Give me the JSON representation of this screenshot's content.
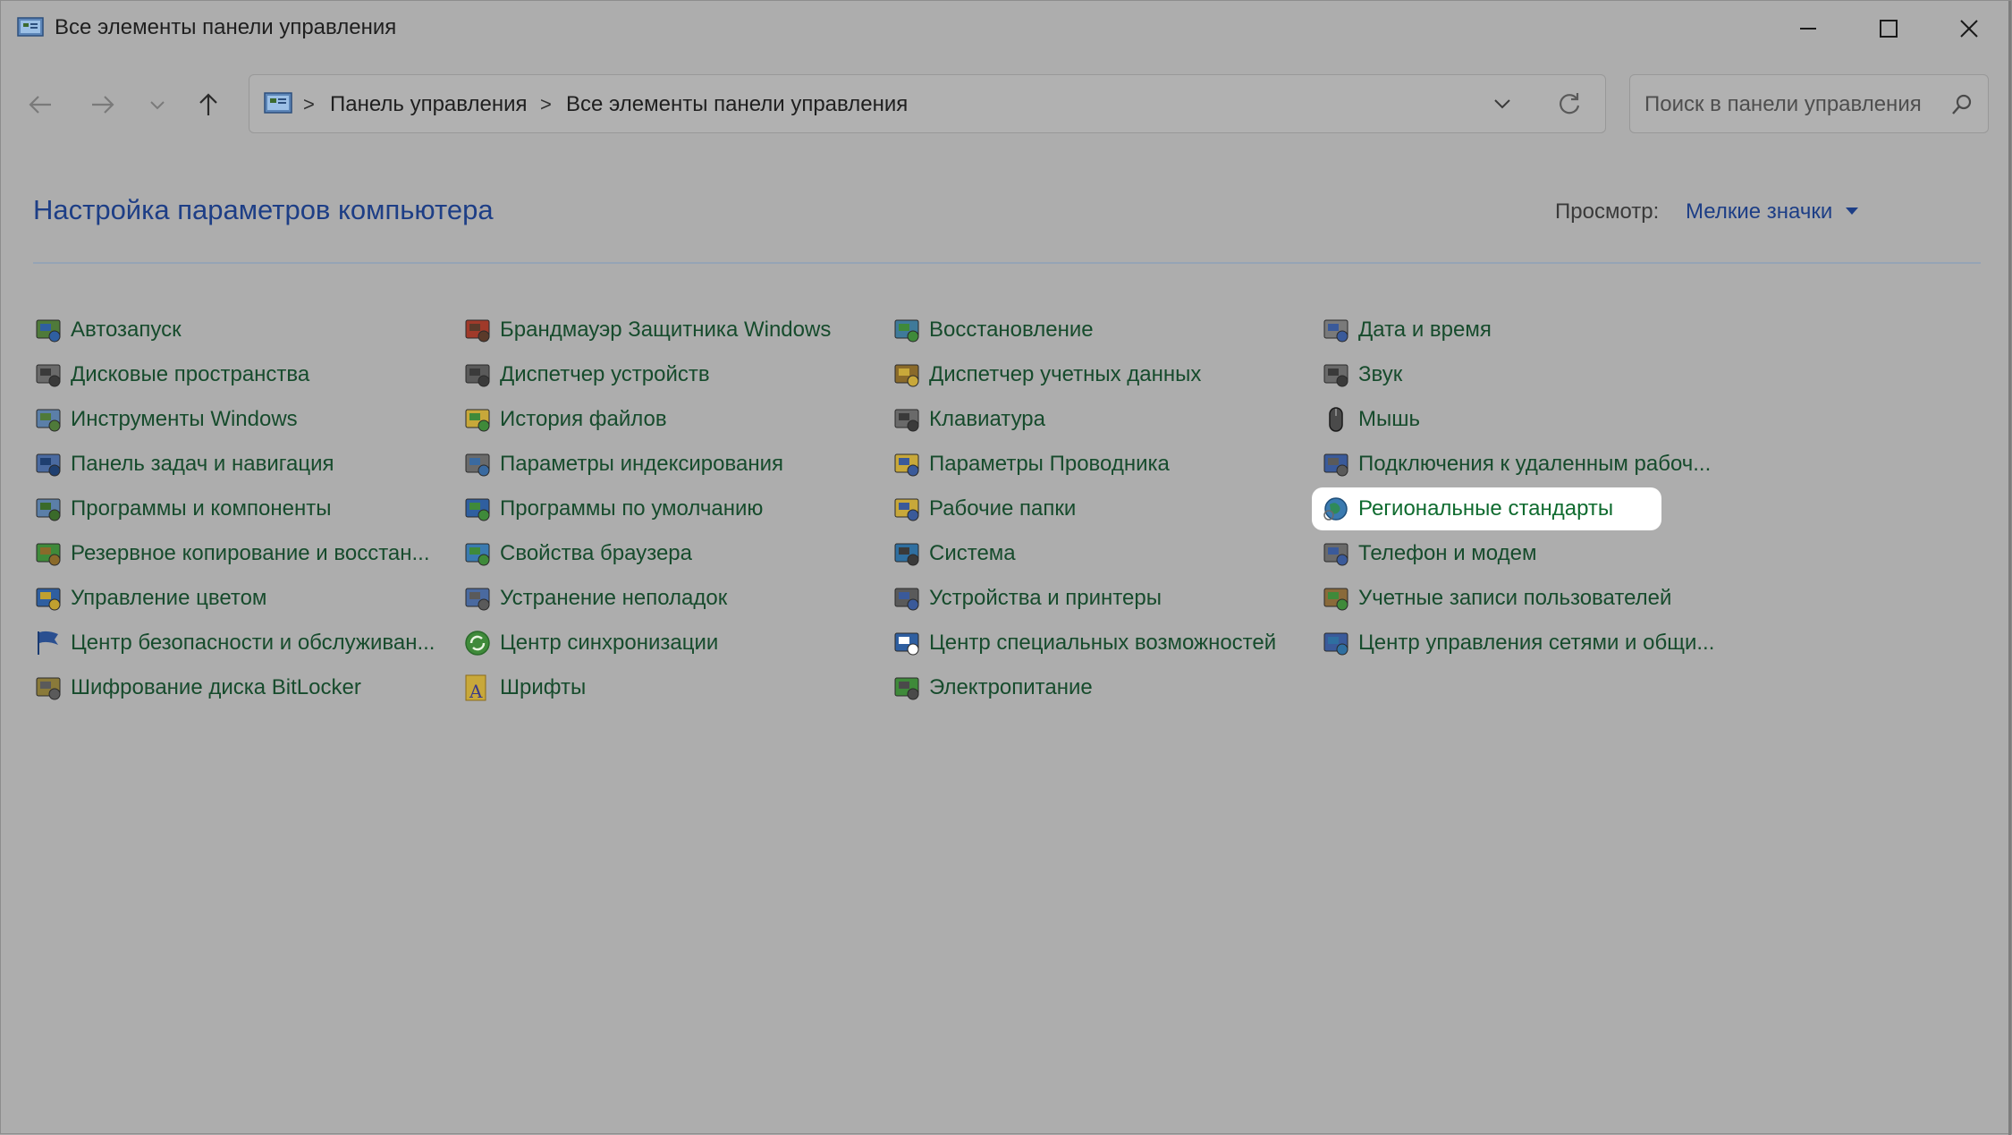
{
  "window": {
    "title": "Все элементы панели управления",
    "controls": {
      "minimize": "minimize-icon",
      "maximize": "maximize-icon",
      "close": "close-icon"
    }
  },
  "nav": {
    "back": "back-arrow-icon",
    "forward": "forward-arrow-icon",
    "recent": "chevron-down-icon",
    "up": "up-arrow-icon"
  },
  "address": {
    "crumbs": [
      "Панель управления",
      "Все элементы панели управления"
    ],
    "separator": ">"
  },
  "search": {
    "placeholder": "Поиск в панели управления"
  },
  "heading": "Настройка параметров компьютера",
  "view": {
    "label": "Просмотр:",
    "value": "Мелкие значки"
  },
  "items": {
    "col1": [
      {
        "label": "Автозапуск",
        "icon": "autoplay-icon"
      },
      {
        "label": "Дисковые пространства",
        "icon": "storage-spaces-icon"
      },
      {
        "label": "Инструменты Windows",
        "icon": "windows-tools-icon"
      },
      {
        "label": "Панель задач и навигация",
        "icon": "taskbar-icon"
      },
      {
        "label": "Программы и компоненты",
        "icon": "programs-icon"
      },
      {
        "label": "Резервное копирование и восстан...",
        "icon": "backup-icon"
      },
      {
        "label": "Управление цветом",
        "icon": "color-management-icon"
      },
      {
        "label": "Центр безопасности и обслуживан...",
        "icon": "security-flag-icon"
      },
      {
        "label": "Шифрование диска BitLocker",
        "icon": "bitlocker-icon"
      }
    ],
    "col2": [
      {
        "label": "Брандмауэр Защитника Windows",
        "icon": "firewall-icon"
      },
      {
        "label": "Диспетчер устройств",
        "icon": "device-manager-icon"
      },
      {
        "label": "История файлов",
        "icon": "file-history-icon"
      },
      {
        "label": "Параметры индексирования",
        "icon": "indexing-icon"
      },
      {
        "label": "Программы по умолчанию",
        "icon": "default-programs-icon"
      },
      {
        "label": "Свойства браузера",
        "icon": "internet-options-icon"
      },
      {
        "label": "Устранение неполадок",
        "icon": "troubleshooting-icon"
      },
      {
        "label": "Центр синхронизации",
        "icon": "sync-center-icon"
      },
      {
        "label": "Шрифты",
        "icon": "fonts-icon"
      }
    ],
    "col3": [
      {
        "label": "Восстановление",
        "icon": "recovery-icon"
      },
      {
        "label": "Диспетчер учетных данных",
        "icon": "credential-manager-icon"
      },
      {
        "label": "Клавиатура",
        "icon": "keyboard-icon"
      },
      {
        "label": "Параметры Проводника",
        "icon": "explorer-options-icon"
      },
      {
        "label": "Рабочие папки",
        "icon": "work-folders-icon"
      },
      {
        "label": "Система",
        "icon": "system-icon"
      },
      {
        "label": "Устройства и принтеры",
        "icon": "devices-printers-icon"
      },
      {
        "label": "Центр специальных возможностей",
        "icon": "ease-of-access-icon"
      },
      {
        "label": "Электропитание",
        "icon": "power-options-icon"
      }
    ],
    "col4": [
      {
        "label": "Дата и время",
        "icon": "date-time-icon"
      },
      {
        "label": "Звук",
        "icon": "sound-icon"
      },
      {
        "label": "Мышь",
        "icon": "mouse-icon"
      },
      {
        "label": "Подключения к удаленным рабоч...",
        "icon": "remote-desktop-icon"
      },
      {
        "label": "Региональные стандарты",
        "icon": "region-globe-icon",
        "highlighted": true
      },
      {
        "label": "Телефон и модем",
        "icon": "phone-modem-icon"
      },
      {
        "label": "Учетные записи пользователей",
        "icon": "user-accounts-icon"
      },
      {
        "label": "Центр управления сетями и общи...",
        "icon": "network-center-icon"
      }
    ]
  },
  "colors": {
    "link": "#164b2c",
    "heading": "#1d3e86",
    "highlight_bg": "#ffffff"
  }
}
